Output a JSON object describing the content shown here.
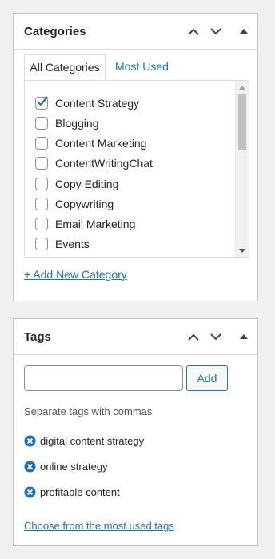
{
  "categories_box": {
    "title": "Categories",
    "tabs": [
      {
        "label": "All Categories",
        "active": true
      },
      {
        "label": "Most Used",
        "active": false
      }
    ],
    "items": [
      {
        "label": "Content Strategy",
        "checked": true
      },
      {
        "label": "Blogging",
        "checked": false
      },
      {
        "label": "Content Marketing",
        "checked": false
      },
      {
        "label": "ContentWritingChat",
        "checked": false
      },
      {
        "label": "Copy Editing",
        "checked": false
      },
      {
        "label": "Copywriting",
        "checked": false
      },
      {
        "label": "Email Marketing",
        "checked": false
      },
      {
        "label": "Events",
        "checked": false
      }
    ],
    "add_new_label": "+ Add New Category"
  },
  "tags_box": {
    "title": "Tags",
    "input_value": "",
    "add_button_label": "Add",
    "hint": "Separate tags with commas",
    "tags": [
      {
        "label": "digital content strategy"
      },
      {
        "label": "online strategy"
      },
      {
        "label": "profitable content"
      }
    ],
    "choose_link": "Choose from the most used tags"
  },
  "icons": {
    "move_up": "chevron-up-icon",
    "move_down": "chevron-down-icon",
    "toggle": "triangle-up-icon",
    "remove_tag": "remove-circle-icon",
    "checked": "checkmark-icon"
  },
  "colors": {
    "link": "#2271b1",
    "checkmark": "#2271b1",
    "border": "#c3c4c7",
    "background": "#f0f0f1"
  }
}
